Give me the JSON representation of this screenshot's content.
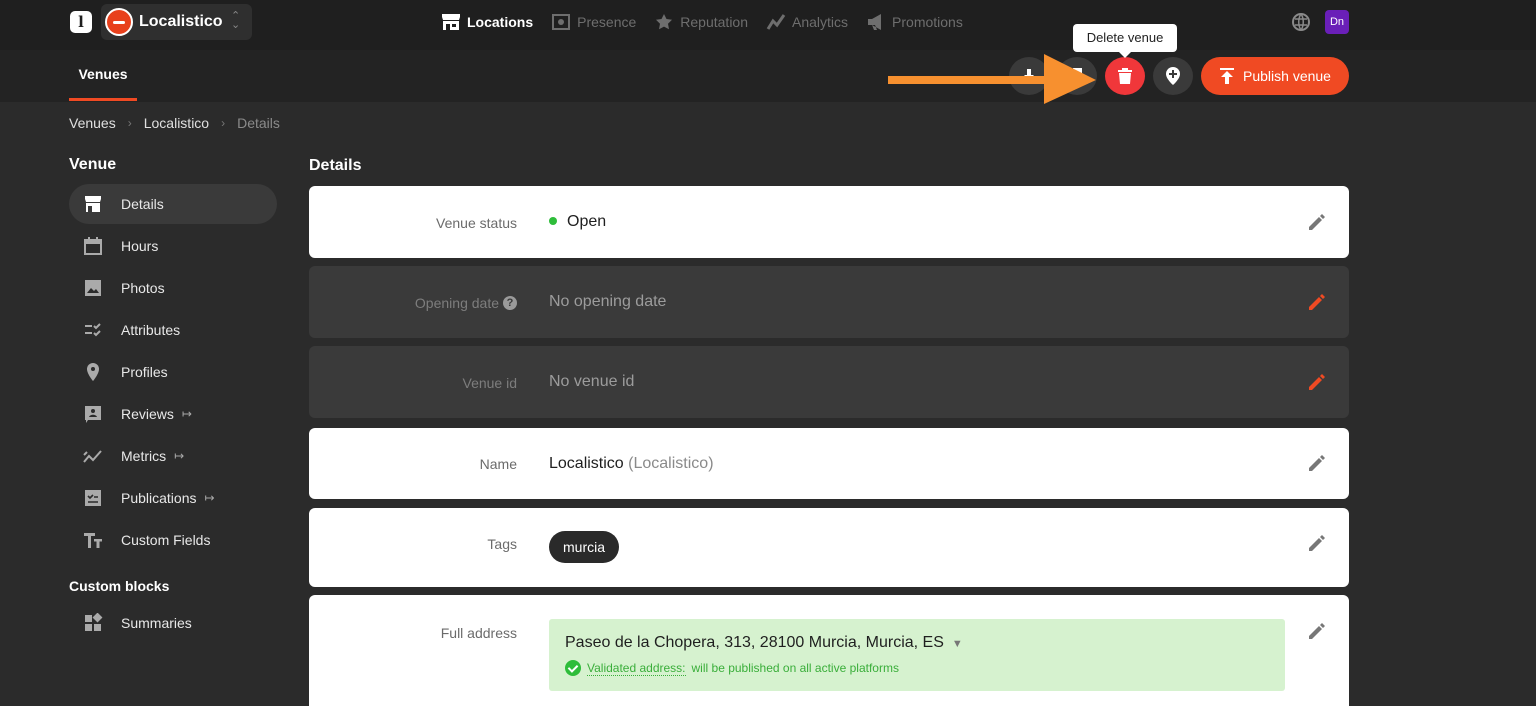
{
  "topbar": {
    "logo_letter": "l",
    "workspace_name": "Localistico",
    "nav": [
      {
        "label": "Locations",
        "icon": "store-icon"
      },
      {
        "label": "Presence",
        "icon": "presence-icon"
      },
      {
        "label": "Reputation",
        "icon": "reputation-icon"
      },
      {
        "label": "Analytics",
        "icon": "analytics-icon"
      },
      {
        "label": "Promotions",
        "icon": "megaphone-icon"
      }
    ],
    "user_initials": "Dn"
  },
  "subbar": {
    "tab": "Venues",
    "tooltip": "Delete venue",
    "publish_label": "Publish venue"
  },
  "breadcrumb": [
    "Venues",
    "Localistico",
    "Details"
  ],
  "sidebar": {
    "title": "Venue",
    "items": [
      {
        "label": "Details",
        "icon": "store-icon",
        "active": true
      },
      {
        "label": "Hours",
        "icon": "calendar-icon"
      },
      {
        "label": "Photos",
        "icon": "image-icon"
      },
      {
        "label": "Attributes",
        "icon": "checklist-icon"
      },
      {
        "label": "Profiles",
        "icon": "pin-icon"
      },
      {
        "label": "Reviews",
        "icon": "review-icon",
        "external": true
      },
      {
        "label": "Metrics",
        "icon": "trend-icon",
        "external": true
      },
      {
        "label": "Publications",
        "icon": "publication-icon",
        "external": true
      },
      {
        "label": "Custom Fields",
        "icon": "text-format-icon"
      }
    ],
    "custom_blocks_title": "Custom blocks",
    "custom_items": [
      {
        "label": "Summaries",
        "icon": "dashboard-icon"
      }
    ],
    "external_glyph": "↦"
  },
  "main": {
    "title": "Details",
    "venue_status": {
      "label": "Venue status",
      "value": "Open"
    },
    "opening_date": {
      "label": "Opening date",
      "value": "No opening date",
      "help": "?"
    },
    "venue_id": {
      "label": "Venue id",
      "value": "No venue id"
    },
    "name": {
      "label": "Name",
      "value": "Localistico",
      "secondary": "(Localistico)"
    },
    "tags": {
      "label": "Tags",
      "values": [
        "murcia"
      ]
    },
    "address": {
      "label": "Full address",
      "value": "Paseo de la Chopera, 313, 28100 Murcia, Murcia, ES",
      "validated_link": "Validated address:",
      "validated_text": "will be published on all active platforms"
    }
  },
  "colors": {
    "accent": "#f04a23",
    "delete": "#f0373a",
    "status_open": "#2ebd3a",
    "arrow": "#f7902f"
  }
}
